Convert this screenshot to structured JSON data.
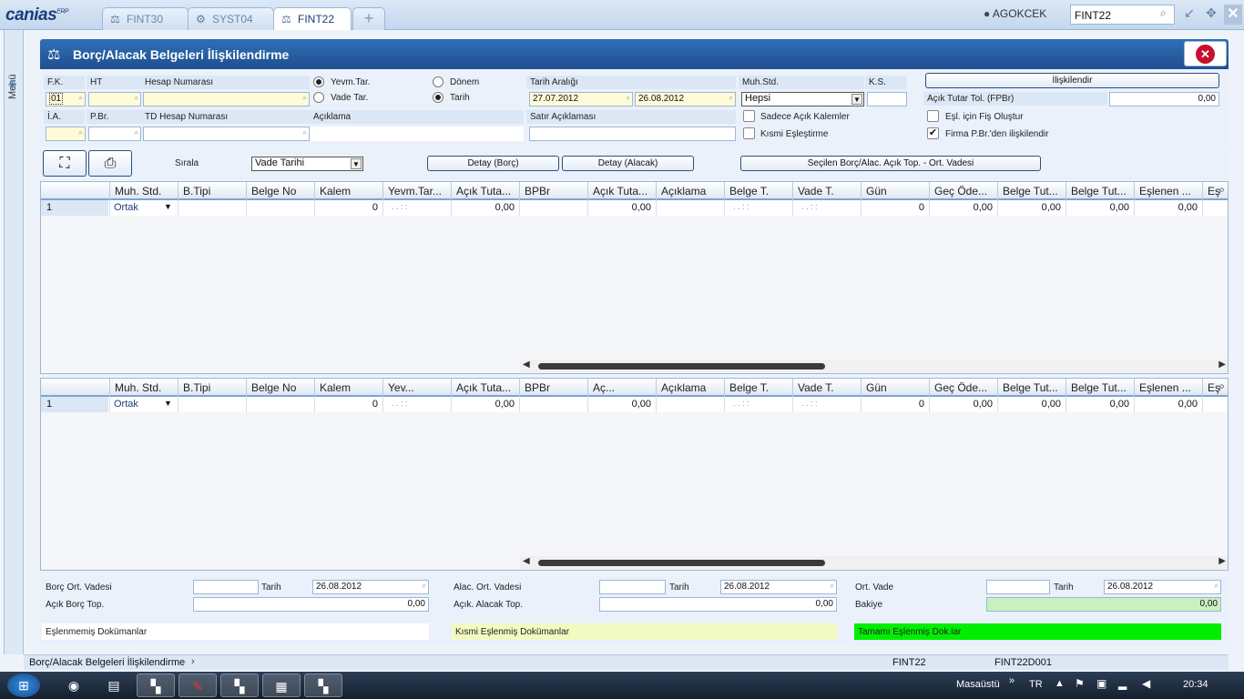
{
  "app": {
    "logo": "canias",
    "logo_sup": "ERP"
  },
  "tabs": [
    {
      "label": "FINT30",
      "icon": "scale-icon",
      "active": false
    },
    {
      "label": "SYST04",
      "icon": "gear-icon",
      "active": false
    },
    {
      "label": "FINT22",
      "icon": "scale-icon",
      "active": true
    }
  ],
  "topbar": {
    "user": "AGOKCEK",
    "search_value": "FINT22"
  },
  "sidemenu": {
    "label": "Menü"
  },
  "window": {
    "title": "Borç/Alacak Belgeleri İlişkilendirme"
  },
  "filters": {
    "fk_label": "F.K.",
    "fk_value": "01",
    "ht_label": "HT",
    "ht_value": "",
    "hesap_label": "Hesap Numarası",
    "hesap_value": "",
    "ia_label": "İ.A.",
    "ia_value": "",
    "pbr_label": "P.Br.",
    "pbr_value": "",
    "tdhesap_label": "TD Hesap Numarası",
    "tdhesap_value": "",
    "aciklama_label": "Açıklama",
    "aciklama_value": "",
    "radio_yevm": "Yevm.Tar.",
    "radio_vade": "Vade Tar.",
    "radio_donem": "Dönem",
    "radio_tarih": "Tarih",
    "tarih_araligi_label": "Tarih Aralığı",
    "tarih_from": "27.07.2012",
    "tarih_to": "26.08.2012",
    "satir_aciklamasi_label": "Satır Açıklaması",
    "satir_aciklamasi_value": "",
    "muhstd_label": "Muh.Std.",
    "muhstd_value": "Hepsi",
    "ks_label": "K.S.",
    "ks_value": "",
    "sadece_acik": "Sadece Açık Kalemler",
    "kismi_eslestirme": "Kısmi Eşleştirme",
    "iliskilendir_button": "İlişkilendir",
    "acik_tutar_tol_label": "Açık Tutar Tol. (FPBr)",
    "acik_tutar_tol_value": "0,00",
    "esl_fis_olustur": "Eşl. için Fiş Oluştur",
    "firma_pbr": "Firma P.Br.'den ilişkilendir"
  },
  "toolbar": {
    "sirala_label": "Sırala",
    "sirala_value": "Vade Tarihi",
    "detay_borc": "Detay (Borç)",
    "detay_alacak": "Detay (Alacak)",
    "secilen_button": "Seçilen Borç/Alac. Açık Top. - Ort. Vadesi"
  },
  "grid1": {
    "headers": [
      "Muh. Std.",
      "B.Tipi",
      "Belge No",
      "Kalem",
      "Yevm.Tar...",
      "Açık Tuta...",
      "BPBr",
      "Açık Tuta...",
      "Açıklama",
      "Belge T.",
      "Vade T.",
      "Gün",
      "Geç Öde...",
      "Belge Tut...",
      "Belge Tut...",
      "Eşlenen ...",
      "Eş"
    ],
    "row": {
      "num": "1",
      "muh": "Ortak",
      "kalem": "0",
      "date_ph": ". .   : :",
      "acik1": "0,00",
      "acik2": "0,00",
      "gun": "0",
      "gec": "0,00",
      "bt1": "0,00",
      "bt2": "0,00",
      "esl": "0,00"
    }
  },
  "grid2": {
    "headers": [
      "Muh. Std.",
      "B.Tipi",
      "Belge No",
      "Kalem",
      "Yev...",
      "Açık Tuta...",
      "BPBr",
      "Aç...",
      "Açıklama",
      "Belge T.",
      "Vade T.",
      "Gün",
      "Geç Öde...",
      "Belge Tut...",
      "Belge Tut...",
      "Eşlenen ...",
      "Eş"
    ],
    "row": {
      "num": "1",
      "muh": "Ortak",
      "kalem": "0",
      "date_ph": ". .   : :",
      "acik1": "0,00",
      "acik2": "0,00",
      "gun": "0",
      "gec": "0,00",
      "bt1": "0,00",
      "bt2": "0,00",
      "esl": "0,00"
    }
  },
  "summary": {
    "borc_ort_vadesi": "Borç Ort. Vadesi",
    "borc_tarih_label": "Tarih",
    "borc_tarih": "26.08.2012",
    "acik_borc_top": "Açık Borç Top.",
    "acik_borc_value": "0,00",
    "alac_ort_vadesi": "Alac. Ort. Vadesi",
    "alac_tarih_label": "Tarih",
    "alac_tarih": "26.08.2012",
    "acik_alacak_top": "Açık. Alacak Top.",
    "acik_alacak_value": "0,00",
    "ort_vade": "Ort. Vade",
    "ort_tarih_label": "Tarih",
    "ort_tarih": "26.08.2012",
    "bakiye": "Bakiye",
    "bakiye_value": "0,00",
    "eslenmemis": "Eşlenmemiş Dokümanlar",
    "kismi_eslenmis": "Kısmi Eşlenmiş Dokümanlar",
    "tamami_eslenmis": "Tamamı Eşlenmiş Dok.lar",
    "colors": {
      "eslenmemis": "#ffffff",
      "kismi": "#f1fac0",
      "tamami": "#00ee00",
      "bakiye": "#c8f0c0"
    }
  },
  "statusbar": {
    "title": "Borç/Alacak Belgeleri İlişkilendirme",
    "code1": "FINT22",
    "code2": "FINT22D001"
  },
  "taskbar": {
    "masaustu": "Masaüstü",
    "lang": "TR",
    "time": "20:34"
  }
}
